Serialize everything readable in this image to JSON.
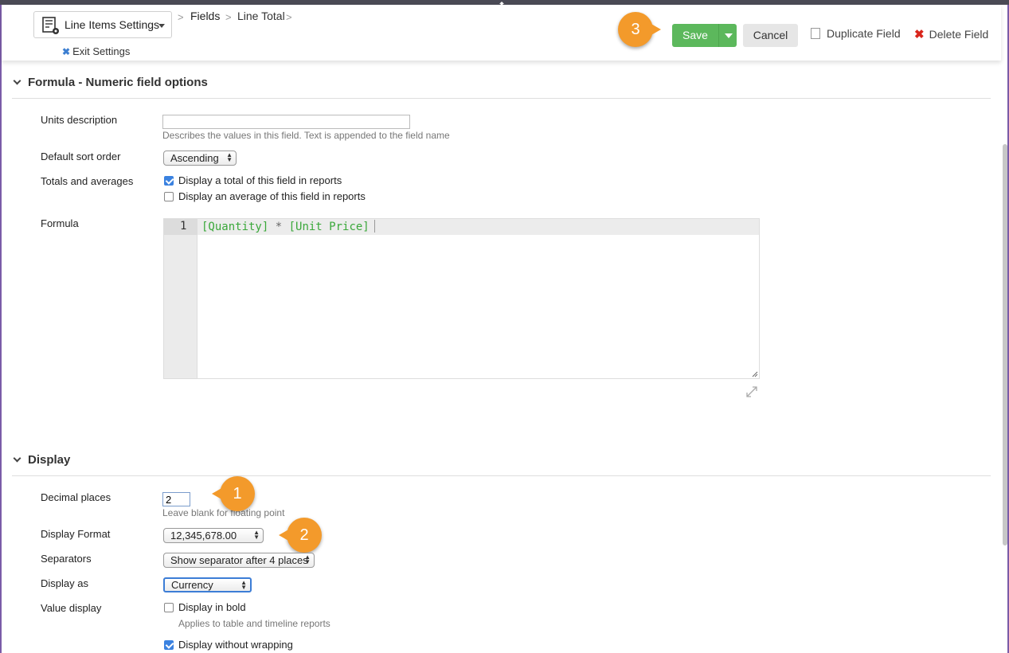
{
  "header": {
    "settings_label": "Line Items Settings",
    "breadcrumbs": [
      "Fields",
      "Line Total"
    ],
    "breadcrumb_sep": ">",
    "exit_label": "Exit Settings",
    "save_label": "Save",
    "cancel_label": "Cancel",
    "duplicate_label": "Duplicate Field",
    "delete_label": "Delete Field"
  },
  "callouts": [
    "1",
    "2",
    "3"
  ],
  "formula_section": {
    "title": "Formula - Numeric field options",
    "units_label": "Units description",
    "units_value": "",
    "units_hint": "Describes the values in this field. Text is appended to the field name",
    "sort_label": "Default sort order",
    "sort_value": "Ascending",
    "totals_label": "Totals and averages",
    "total_option": "Display a total of this field in reports",
    "total_checked": true,
    "average_option": "Display an average of this field in reports",
    "average_checked": false,
    "formula_label": "Formula",
    "formula_line_no": "1",
    "formula_tokens": [
      "[Quantity]",
      " * ",
      "[Unit Price]"
    ]
  },
  "display_section": {
    "title": "Display",
    "decimal_label": "Decimal places",
    "decimal_value": "2",
    "decimal_hint": "Leave blank for floating point",
    "format_label": "Display Format",
    "format_value": "12,345,678.00",
    "separators_label": "Separators",
    "separators_value": "Show separator after 4 places",
    "display_as_label": "Display as",
    "display_as_value": "Currency",
    "value_display_label": "Value display",
    "bold_option": "Display in bold",
    "bold_checked": false,
    "bold_hint": "Applies to table and timeline reports",
    "nowrap_option": "Display without wrapping",
    "nowrap_checked": true
  },
  "colors": {
    "save_green": "#5cb85c",
    "callout_orange": "#f39a2b",
    "delete_red": "#d9261c",
    "code_green": "#3aa83a",
    "checkbox_blue": "#3b82e0"
  },
  "icons": [
    "settings-list-icon",
    "chevron-down-icon",
    "close-icon",
    "duplicate-icon",
    "delete-icon",
    "expand-icon",
    "collapse-up-icon"
  ]
}
